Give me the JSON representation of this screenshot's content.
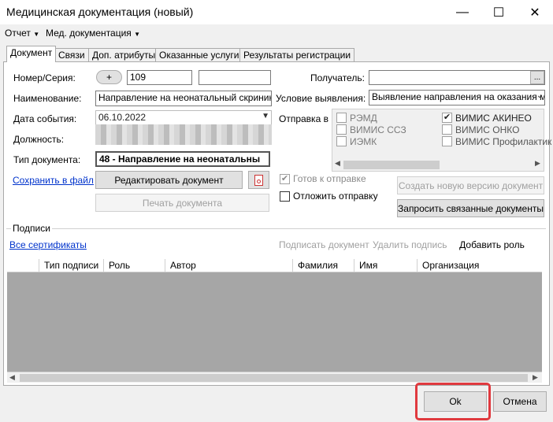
{
  "window": {
    "title": "Медицинская документация (новый)"
  },
  "menu": {
    "items": [
      "Отчет",
      "Мед. документация"
    ]
  },
  "tabs": [
    "Документ",
    "Связи",
    "Доп. атрибуты",
    "Оказанные услуги",
    "Результаты регистрации"
  ],
  "form": {
    "number_label": "Номер/Серия:",
    "plus_label": "+",
    "number_value": "109",
    "series_value": "",
    "name_label": "Наименование:",
    "name_value": "Направление на неонатальный скрининг",
    "event_date_label": "Дата события:",
    "event_date_value": "06.10.2022",
    "position_label": "Должность:",
    "doc_type_label": "Тип документа:",
    "doc_type_value": "48 - Направление на неонатальны",
    "recipient_label": "Получатель:",
    "recipient_value": "",
    "recipient_browse": "...",
    "condition_label": "Условие выявления:",
    "condition_value": "Выявление направления на оказания м",
    "send_label": "Отправка в",
    "send_options_left": [
      {
        "label": "РЭМД",
        "checked": false
      },
      {
        "label": "ВИМИС ССЗ",
        "checked": false
      },
      {
        "label": "ИЭМК",
        "checked": false
      }
    ],
    "send_options_right": [
      {
        "label": "ВИМИС АКИНЕО",
        "checked": true
      },
      {
        "label": "ВИМИС ОНКО",
        "checked": false
      },
      {
        "label": "ВИМИС Профилактик",
        "checked": false
      }
    ],
    "save_to_file": "Сохранить в файл",
    "edit_document": "Редактировать документ",
    "print_document": "Печать документа",
    "ready_to_send": "Готов к отправке",
    "postpone_send": "Отложить отправку",
    "create_version": "Создать новую версию документ",
    "request_related": "Запросить связанные документы"
  },
  "signatures": {
    "group_label": "Подписи",
    "all_certificates": "Все сертификаты",
    "sign_document": "Подписать документ",
    "delete_signature": "Удалить подпись",
    "add_role": "Добавить роль",
    "columns": [
      "Тип подписи",
      "Роль",
      "Автор",
      "Фамилия",
      "Имя",
      "Организация"
    ]
  },
  "footer": {
    "ok": "Ok",
    "cancel": "Отмена"
  },
  "colors": {
    "highlight": "#e0393e",
    "link": "#0033cc"
  }
}
